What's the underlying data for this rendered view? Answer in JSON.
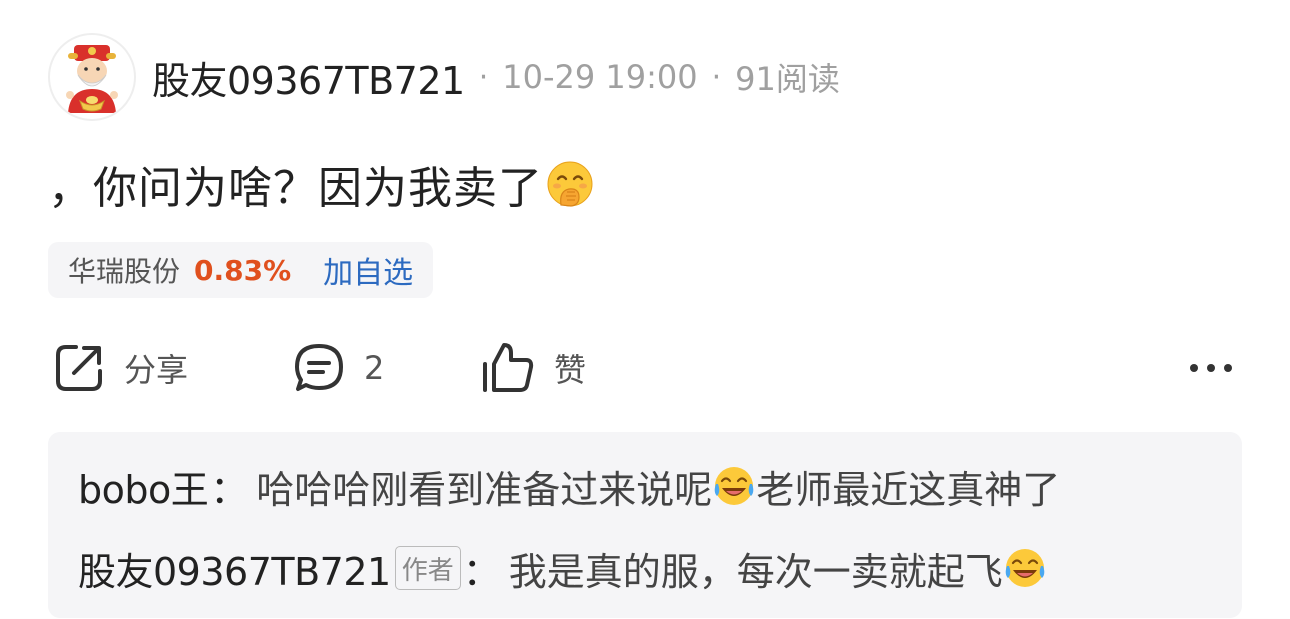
{
  "post": {
    "author": "股友09367TB721",
    "sep1": "·",
    "time": "10-29 19:00",
    "sep2": "·",
    "reads": "91阅读",
    "content": "，你问为啥？因为我卖了",
    "content_emoji": "covering-mouth-laugh-emoji-icon"
  },
  "stock": {
    "name": "华瑞股份",
    "change": "0.83%",
    "add_label": "加自选",
    "change_color": "#e0501e",
    "add_color": "#2c6ac0"
  },
  "actions": {
    "share_label": "分享",
    "comment_count": "2",
    "like_label": "赞"
  },
  "comments": [
    {
      "user": "bobo王",
      "colon": "：",
      "text_before": "哈哈哈刚看到准备过来说呢",
      "emoji": "crying-laughing-emoji-icon",
      "text_after": "老师最近这真神了"
    },
    {
      "user": "股友09367TB721",
      "tag": "作者",
      "colon": "：",
      "text_before": "我是真的服，每次一卖就起飞",
      "emoji": "crying-laughing-emoji-icon",
      "text_after": ""
    }
  ]
}
